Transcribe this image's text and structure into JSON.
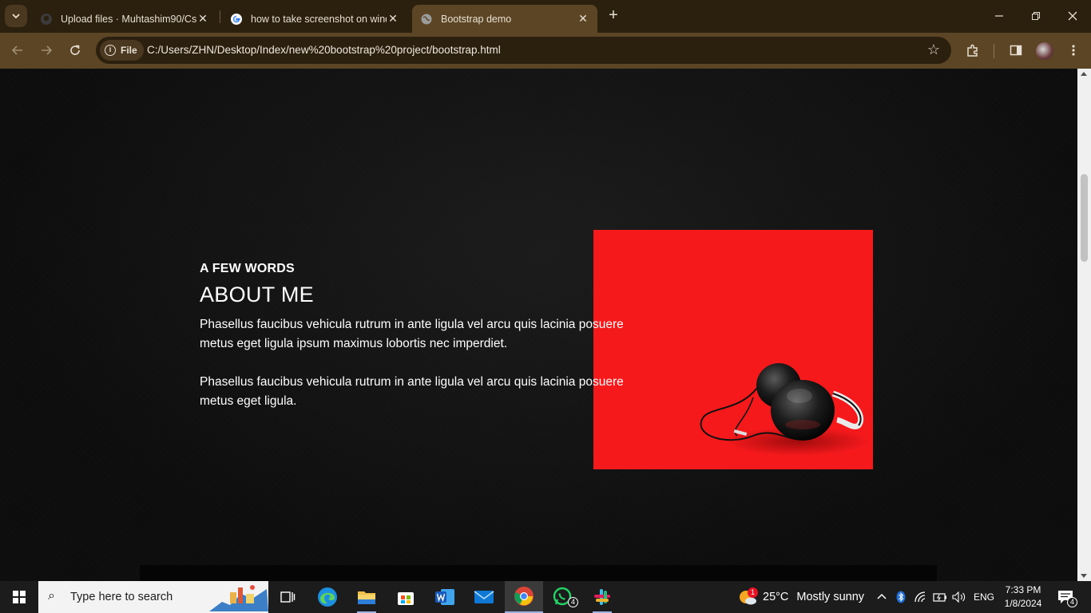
{
  "browser": {
    "tabs": [
      {
        "title": "Upload files · Muhtashim90/Css",
        "favicon": "github-icon"
      },
      {
        "title": "how to take screenshot on wind",
        "favicon": "google-icon"
      },
      {
        "title": "Bootstrap demo",
        "favicon": "globe-icon",
        "active": true
      }
    ],
    "chip_label": "File",
    "url": "C:/Users/ZHN/Desktop/Index/new%20bootstrap%20project/bootstrap.html"
  },
  "page": {
    "eyebrow": "A FEW WORDS",
    "heading": "ABOUT ME",
    "paragraphs": [
      "Phasellus faucibus vehicula rutrum in ante ligula vel arcu quis lacinia posuere metus eget ligula ipsum maximus lobortis nec imperdiet.",
      "Phasellus faucibus vehicula rutrum in ante ligula vel arcu quis lacinia posuere metus eget ligula."
    ],
    "image_background": "#f5191c"
  },
  "taskbar": {
    "search_placeholder": "Type here to search",
    "weather": {
      "temp": "25°C",
      "condition": "Mostly sunny",
      "alert_count": "1"
    },
    "language": "ENG",
    "time": "7:33 PM",
    "date": "1/8/2024",
    "whatsapp_badge": "4",
    "notification_count": "4"
  }
}
